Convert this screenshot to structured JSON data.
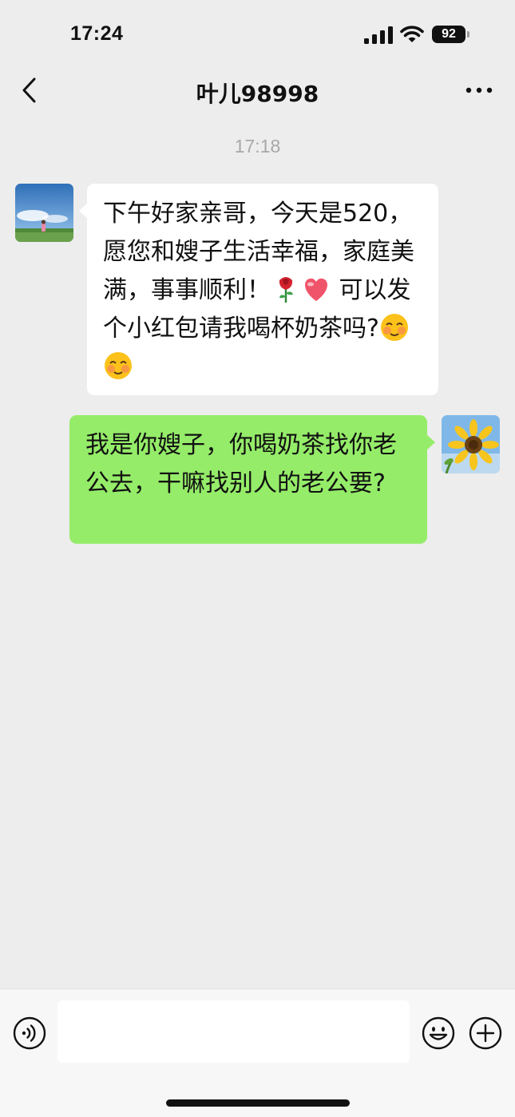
{
  "status_bar": {
    "time": "17:24",
    "battery_level": "92",
    "icons": [
      "signal-icon",
      "wifi-icon",
      "battery-icon"
    ]
  },
  "nav": {
    "back_icon": "chevron-left-icon",
    "title": "叶儿98998",
    "more_icon": "more-horizontal-icon"
  },
  "timestamp": "17:18",
  "messages": [
    {
      "sender": "other",
      "avatar_icon": "landscape-avatar",
      "text": "下午好家亲哥，今天是520，愿您和嫂子生活幸福，家庭美满，事事顺利！",
      "line2_text": " 可以发个小红包请我喝杯奶茶吗?",
      "emojis": [
        "rose-emoji",
        "heart-emoji",
        "shy-face-emoji",
        "shy-face-emoji"
      ]
    },
    {
      "sender": "self",
      "avatar_icon": "sunflower-avatar",
      "text": "我是你嫂子，你喝奶茶找你老公去，干嘛找别人的老公要?"
    }
  ],
  "input_bar": {
    "voice_icon": "voice-icon",
    "input_value": "",
    "emoji_icon": "emoji-icon",
    "plus_icon": "plus-icon"
  },
  "colors": {
    "background": "#ededed",
    "self_bubble": "#95ec69",
    "other_bubble": "#ffffff",
    "timestamp": "#a8a8a8"
  }
}
